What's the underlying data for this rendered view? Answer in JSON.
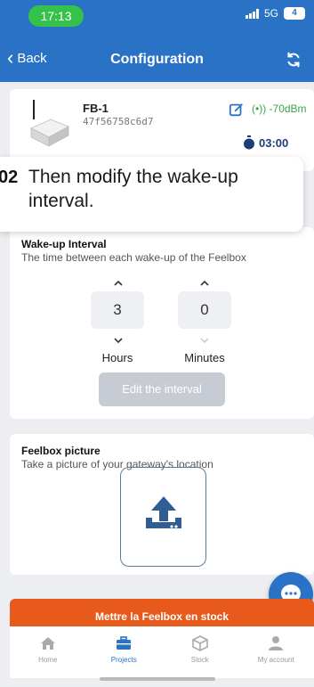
{
  "status_bar": {
    "time": "17:13",
    "network": "5G",
    "battery": "4"
  },
  "header": {
    "back_label": "Back",
    "title": "Configuration"
  },
  "device": {
    "name": "FB-1",
    "id": "47f56758c6d7",
    "rssi": "(•)) -70dBm",
    "timer": "03:00"
  },
  "tooltip": {
    "step": "02",
    "text": "Then modify the wake-up interval."
  },
  "wakeup": {
    "title": "Wake-up Interval",
    "subtitle": "The time between each wake-up of the Feelbox",
    "hours_value": "3",
    "minutes_value": "0",
    "hours_label": "Hours",
    "minutes_label": "Minutes",
    "edit_button": "Edit the interval"
  },
  "picture": {
    "title": "Feelbox picture",
    "subtitle": "Take a picture of your gateway's location"
  },
  "stock_button": "Mettre la Feelbox en stock",
  "tabs": [
    {
      "label": "Home",
      "icon": "home-icon"
    },
    {
      "label": "Projects",
      "icon": "briefcase-icon"
    },
    {
      "label": "Stock",
      "icon": "box-icon"
    },
    {
      "label": "My account",
      "icon": "user-icon"
    }
  ],
  "colors": {
    "primary": "#2a72c6",
    "accent_orange": "#e85a1c",
    "signal_green": "#3aa64a",
    "status_green": "#35c24a"
  }
}
